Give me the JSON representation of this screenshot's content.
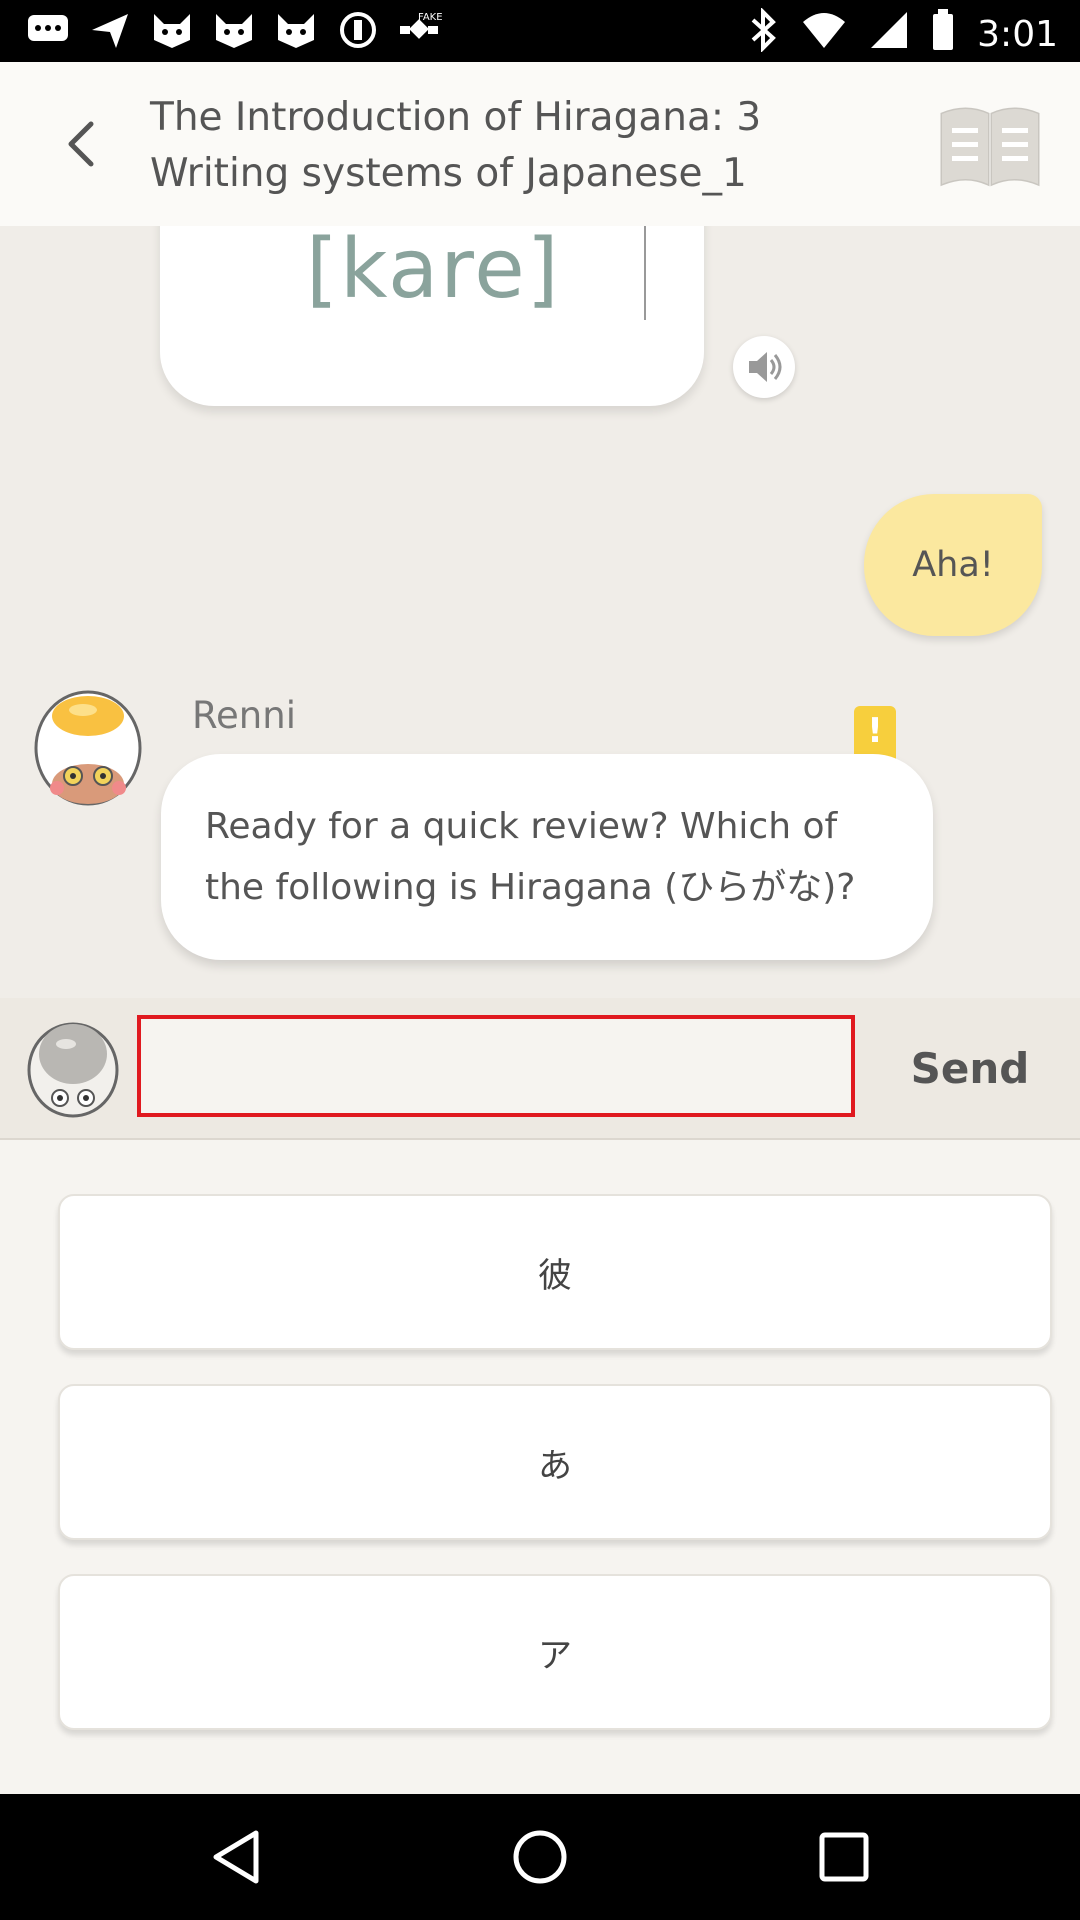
{
  "status_bar": {
    "time": "3:01",
    "fake_label": "FAKE",
    "left_icons": [
      "chat-icon",
      "navigation-icon",
      "cat-icon",
      "cat-icon",
      "cat-icon",
      "sync-icon",
      "satellite-icon"
    ],
    "right_icons": [
      "bluetooth-icon",
      "wifi-icon",
      "signal-icon",
      "battery-icon"
    ]
  },
  "header": {
    "title": "The Introduction of Hiragana: 3 Writing systems of Japanese_1",
    "back_icon": "chevron-left-icon",
    "book_icon": "book-icon"
  },
  "chat": {
    "card_text": "[kare]",
    "speaker_icon": "speaker-icon",
    "user_reply": "Aha!",
    "bot_name": "Renni",
    "alert_mark": "!",
    "bot_message": "Ready for a quick review? Which of the following is Hiragana (ひらがな)?"
  },
  "composer": {
    "input_value": "",
    "send_label": "Send"
  },
  "options": [
    "彼",
    "あ",
    "ア"
  ],
  "colors": {
    "background": "#f0ede8",
    "user_bubble": "#fbe89f",
    "input_border": "#e0191f",
    "alert": "#f7cf3d"
  }
}
